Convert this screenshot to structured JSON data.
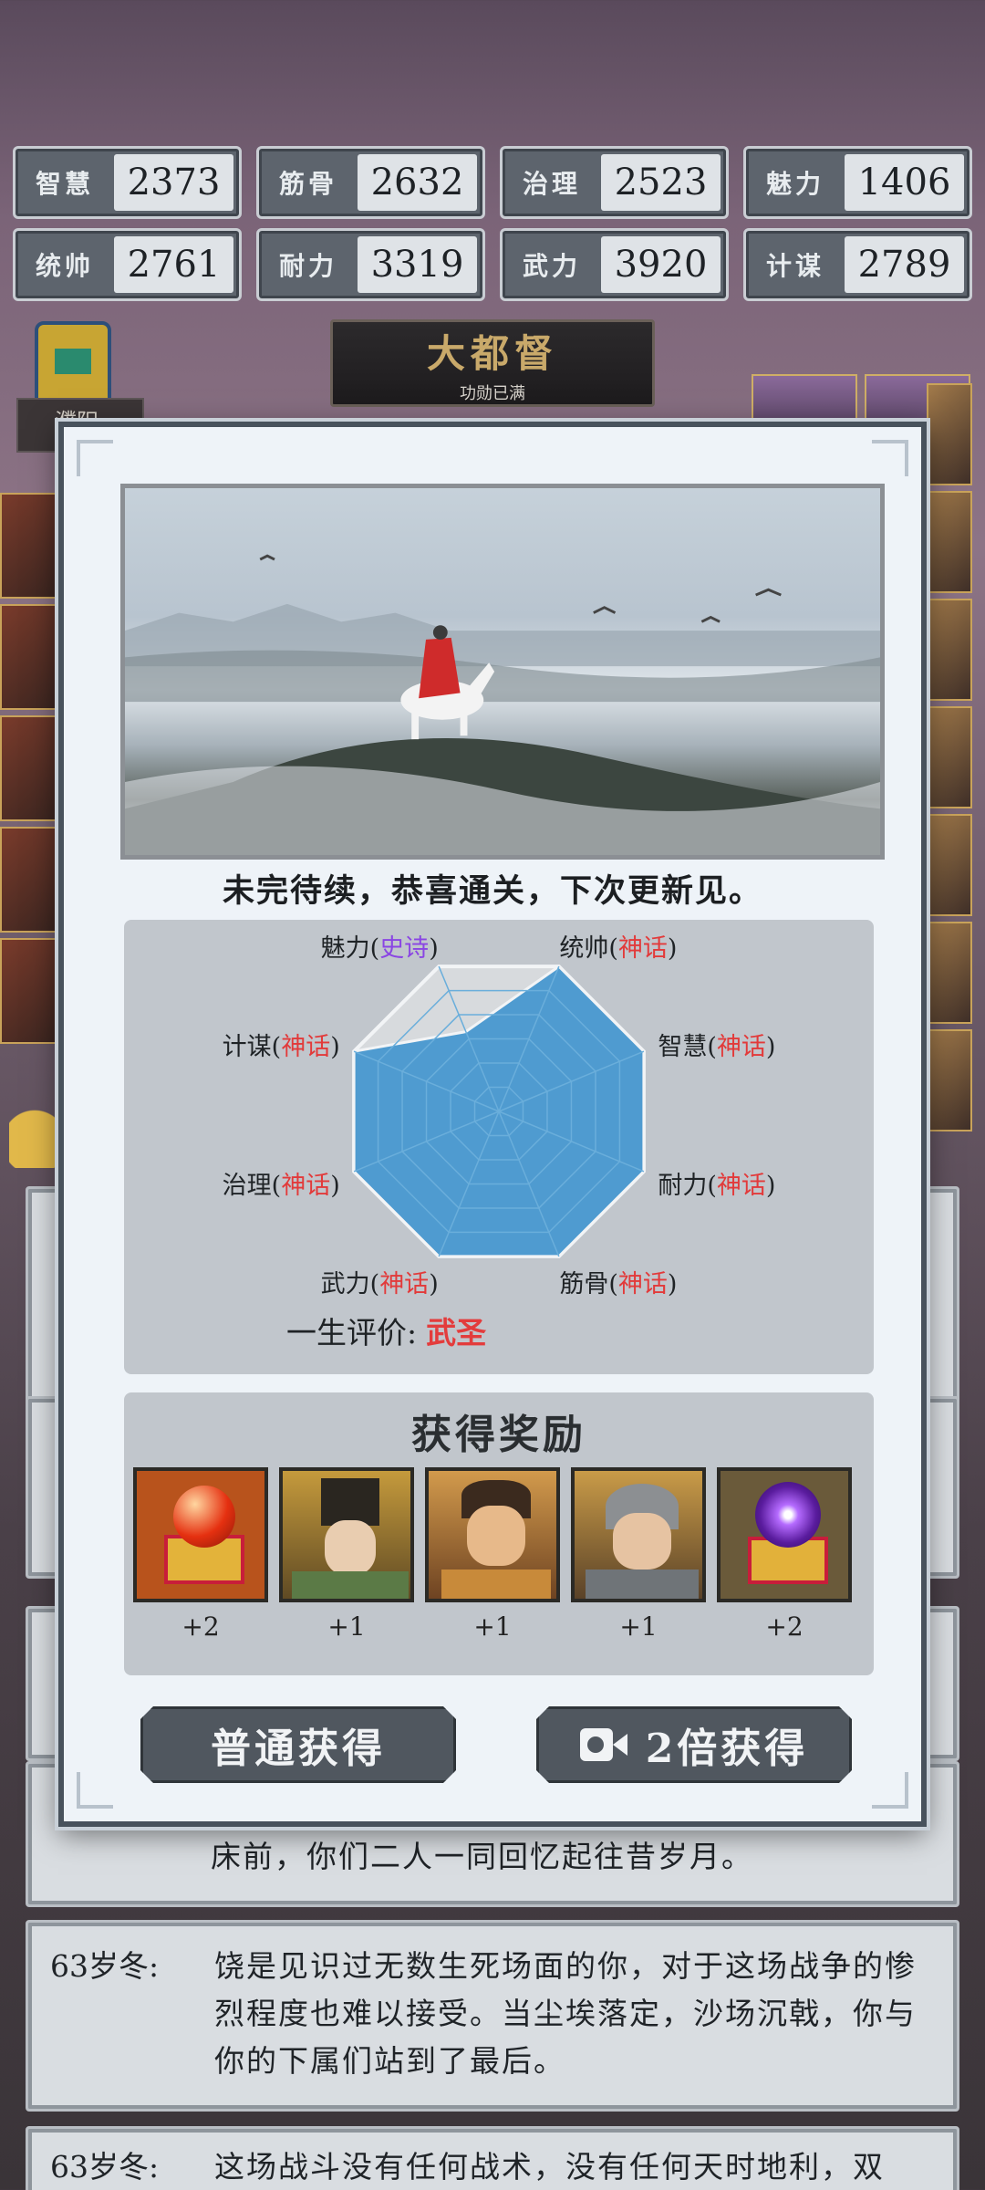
{
  "stats": [
    {
      "name": "智慧",
      "value": "2373"
    },
    {
      "name": "筋骨",
      "value": "2632"
    },
    {
      "name": "治理",
      "value": "2523"
    },
    {
      "name": "魅力",
      "value": "1406"
    },
    {
      "name": "统帅",
      "value": "2761"
    },
    {
      "name": "耐力",
      "value": "3319"
    },
    {
      "name": "武力",
      "value": "3920"
    },
    {
      "name": "计谋",
      "value": "2789"
    }
  ],
  "rank": {
    "title": "大都督",
    "subtitle": "功勋已满"
  },
  "place_tag": "濮阳",
  "background_log": [
    {
      "age": "",
      "text": "床前，你们二人一同回忆起往昔岁月。"
    },
    {
      "age": "63岁冬:",
      "text": "饶是见识过无数生死场面的你，对于这场战争的惨烈程度也难以接受。当尘埃落定，沙场沉戟，你与你的下属们站到了最后。"
    },
    {
      "age": "63岁冬:",
      "text": "这场战斗没有任何战术，没有任何天时地利，双"
    }
  ],
  "modal": {
    "ending_text": "未完待续，恭喜通关，下次更新见。",
    "radar": {
      "axes": [
        {
          "name": "统帅",
          "grade": "神话",
          "tier": "myth",
          "fill": 1.0
        },
        {
          "name": "智慧",
          "grade": "神话",
          "tier": "myth",
          "fill": 1.0
        },
        {
          "name": "耐力",
          "grade": "神话",
          "tier": "myth",
          "fill": 1.0
        },
        {
          "name": "筋骨",
          "grade": "神话",
          "tier": "myth",
          "fill": 1.0
        },
        {
          "name": "武力",
          "grade": "神话",
          "tier": "myth",
          "fill": 1.0
        },
        {
          "name": "治理",
          "grade": "神话",
          "tier": "myth",
          "fill": 1.0
        },
        {
          "name": "计谋",
          "grade": "神话",
          "tier": "myth",
          "fill": 1.0
        },
        {
          "name": "魅力",
          "grade": "史诗",
          "tier": "epic",
          "fill": 0.55
        }
      ],
      "fill_color": "#4f9bd0",
      "outline_color": "#f2f4f6"
    },
    "evaluation": {
      "label": "一生评价:",
      "value": "武圣"
    },
    "rewards_title": "获得奖励",
    "rewards": [
      {
        "icon": "red-orb-chest-icon",
        "qty": "+2"
      },
      {
        "icon": "general-portrait-icon",
        "qty": "+1"
      },
      {
        "icon": "warrior-portrait-icon",
        "qty": "+1"
      },
      {
        "icon": "helmeted-general-portrait-icon",
        "qty": "+1"
      },
      {
        "icon": "purple-orb-chest-icon",
        "qty": "+2"
      }
    ],
    "buttons": {
      "normal": "普通获得",
      "double": "2倍获得"
    }
  }
}
